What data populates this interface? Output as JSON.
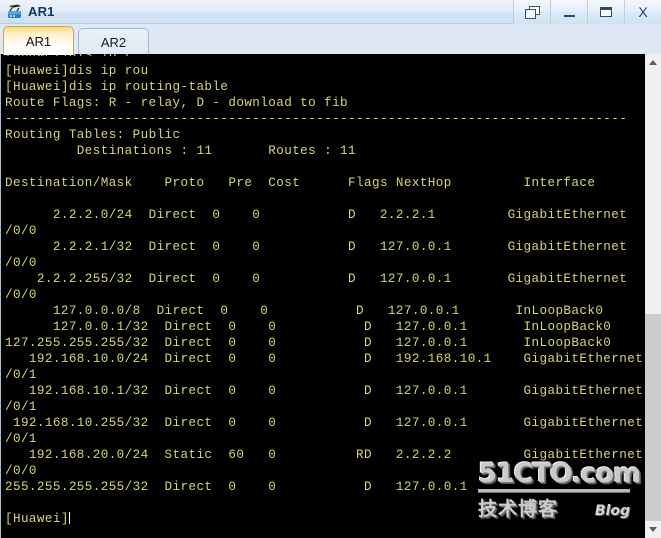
{
  "window": {
    "title": "AR1",
    "icon": "router-device-icon",
    "buttons": [
      {
        "name": "restore-window-button",
        "icon": "restore-icon",
        "label": ""
      },
      {
        "name": "minimize-window-button",
        "icon": "minimize-icon",
        "label": ""
      },
      {
        "name": "maximize-window-button",
        "icon": "maximize-icon",
        "label": ""
      },
      {
        "name": "close-window-button",
        "icon": "close-icon",
        "label": "X"
      }
    ]
  },
  "tabs": [
    {
      "label": "AR1",
      "active": true
    },
    {
      "label": "AR2",
      "active": false
    }
  ],
  "terminal": {
    "foreground": "#d8d86a",
    "background": "#000000",
    "cursor_color": "#ffffff",
    "lines": [
      "[Huawei]dis ip r",
      "[Huawei]dis ip rou",
      "[Huawei]dis ip routing-table",
      "Route Flags: R - relay, D - download to fib",
      "------------------------------------------------------------------------------",
      "Routing Tables: Public",
      "         Destinations : 11       Routes : 11",
      "",
      "Destination/Mask    Proto   Pre  Cost      Flags NextHop         Interface",
      "",
      "      2.2.2.0/24  Direct  0    0           D   2.2.2.1         GigabitEthernet",
      "/0/0",
      "      2.2.2.1/32  Direct  0    0           D   127.0.0.1       GigabitEthernet",
      "/0/0",
      "    2.2.2.255/32  Direct  0    0           D   127.0.0.1       GigabitEthernet",
      "/0/0",
      "      127.0.0.0/8  Direct  0    0           D   127.0.0.1       InLoopBack0",
      "      127.0.0.1/32  Direct  0    0           D   127.0.0.1       InLoopBack0",
      "127.255.255.255/32  Direct  0    0           D   127.0.0.1       InLoopBack0",
      "   192.168.10.0/24  Direct  0    0           D   192.168.10.1    GigabitEthernet",
      "/0/1",
      "   192.168.10.1/32  Direct  0    0           D   127.0.0.1       GigabitEthernet",
      "/0/1",
      " 192.168.10.255/32  Direct  0    0           D   127.0.0.1       GigabitEthernet",
      "/0/1",
      "   192.168.20.0/24  Static  60   0          RD   2.2.2.2         GigabitEthernet",
      "/0/0",
      "255.255.255.255/32  Direct  0    0           D   127.0.0.1",
      "",
      "[Huawei]"
    ],
    "prompt": "[Huawei]",
    "routing_table": {
      "route_flags_legend": "Route Flags: R - relay, D - download to fib",
      "table_name": "Routing Tables: Public",
      "destinations": "11",
      "routes": "11",
      "columns": [
        "Destination/Mask",
        "Proto",
        "Pre",
        "Cost",
        "Flags",
        "NextHop",
        "Interface"
      ],
      "rows": [
        {
          "destination": "2.2.2.0/24",
          "proto": "Direct",
          "pre": "0",
          "cost": "0",
          "flags": "D",
          "nexthop": "2.2.2.1",
          "interface": "GigabitEthernet0/0/0"
        },
        {
          "destination": "2.2.2.1/32",
          "proto": "Direct",
          "pre": "0",
          "cost": "0",
          "flags": "D",
          "nexthop": "127.0.0.1",
          "interface": "GigabitEthernet0/0/0"
        },
        {
          "destination": "2.2.2.255/32",
          "proto": "Direct",
          "pre": "0",
          "cost": "0",
          "flags": "D",
          "nexthop": "127.0.0.1",
          "interface": "GigabitEthernet0/0/0"
        },
        {
          "destination": "127.0.0.0/8",
          "proto": "Direct",
          "pre": "0",
          "cost": "0",
          "flags": "D",
          "nexthop": "127.0.0.1",
          "interface": "InLoopBack0"
        },
        {
          "destination": "127.0.0.1/32",
          "proto": "Direct",
          "pre": "0",
          "cost": "0",
          "flags": "D",
          "nexthop": "127.0.0.1",
          "interface": "InLoopBack0"
        },
        {
          "destination": "127.255.255.255/32",
          "proto": "Direct",
          "pre": "0",
          "cost": "0",
          "flags": "D",
          "nexthop": "127.0.0.1",
          "interface": "InLoopBack0"
        },
        {
          "destination": "192.168.10.0/24",
          "proto": "Direct",
          "pre": "0",
          "cost": "0",
          "flags": "D",
          "nexthop": "192.168.10.1",
          "interface": "GigabitEthernet0/0/1"
        },
        {
          "destination": "192.168.10.1/32",
          "proto": "Direct",
          "pre": "0",
          "cost": "0",
          "flags": "D",
          "nexthop": "127.0.0.1",
          "interface": "GigabitEthernet0/0/1"
        },
        {
          "destination": "192.168.10.255/32",
          "proto": "Direct",
          "pre": "0",
          "cost": "0",
          "flags": "D",
          "nexthop": "127.0.0.1",
          "interface": "GigabitEthernet0/0/1"
        },
        {
          "destination": "192.168.20.0/24",
          "proto": "Static",
          "pre": "60",
          "cost": "0",
          "flags": "RD",
          "nexthop": "2.2.2.2",
          "interface": "GigabitEthernet0/0/0"
        },
        {
          "destination": "255.255.255.255/32",
          "proto": "Direct",
          "pre": "0",
          "cost": "0",
          "flags": "D",
          "nexthop": "127.0.0.1",
          "interface": ""
        }
      ]
    }
  },
  "watermark": {
    "main": "51CTO.com",
    "sub_cn": "技术博客",
    "sub_en": "Blog"
  },
  "scrollbar": {
    "up_arrow": "scroll-up-arrow",
    "down_arrow": "scroll-down-arrow",
    "thumb_top_pct": 54,
    "thumb_height_pct": 46
  }
}
